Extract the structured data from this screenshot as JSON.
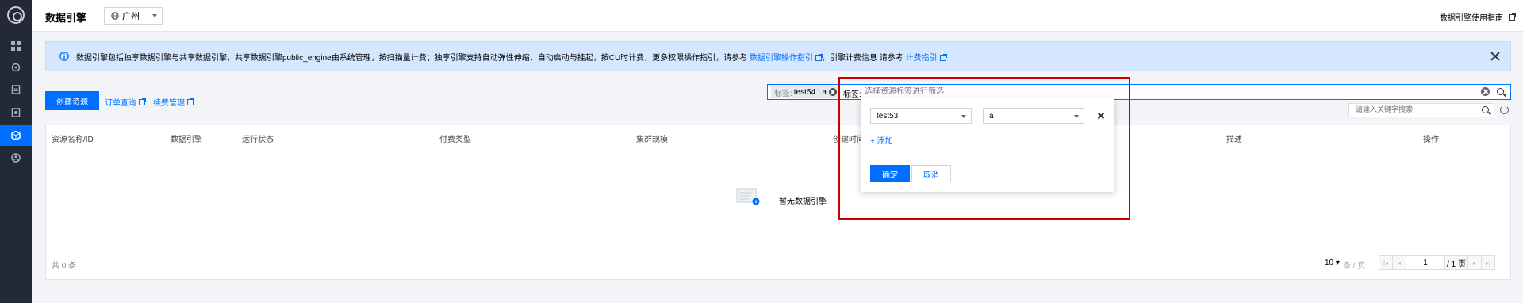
{
  "header": {
    "title": "数据引擎",
    "region": "广州",
    "guide_link": "数据引擎使用指南"
  },
  "notice": {
    "text": "数据引擎包括独享数据引擎与共享数据引擎，共享数据引擎public_engine由系统管理，按扫描量计费；独享引擎支持自动弹性伸缩、自动启动与挂起，按CU时计费，更多权限操作指引，请参考",
    "link1": "数据引擎操作指引",
    "mid": "，引擎计费信息 请参考",
    "link2": "计费指引"
  },
  "toolbar": {
    "create_button": "创建资源",
    "order_link": "订单查询",
    "renew_link": "续费管理"
  },
  "tag_search": {
    "chip_key": "标签:",
    "chip_value": "test54 : a",
    "prefix": "标签:",
    "placeholder": "选择资源标签进行筛选"
  },
  "keyword_search": {
    "placeholder": "请输入关键字搜索"
  },
  "table": {
    "columns": [
      "资源名称/ID",
      "数据引擎",
      "运行状态",
      "付费类型",
      "集群规模",
      "创建时间",
      "描述",
      "操作"
    ],
    "empty_text": "暂无数据引擎"
  },
  "footer": {
    "total": "共 0 条",
    "page_size": "10",
    "page_size_unit": "条 / 页",
    "current_page": "1",
    "total_pages": "/ 1 页"
  },
  "tag_dropdown": {
    "key_value": "test53",
    "value_value": "a",
    "add_label": "添加",
    "confirm_label": "确定",
    "cancel_label": "取消"
  },
  "colors": {
    "primary": "#006eff",
    "sidebar": "#232a36",
    "highlight": "#cc0000"
  },
  "icons": {
    "logo": "logo-icon",
    "nav": [
      "grid-icon",
      "search-icon",
      "document-icon",
      "report-icon",
      "engine-icon",
      "user-icon"
    ]
  }
}
